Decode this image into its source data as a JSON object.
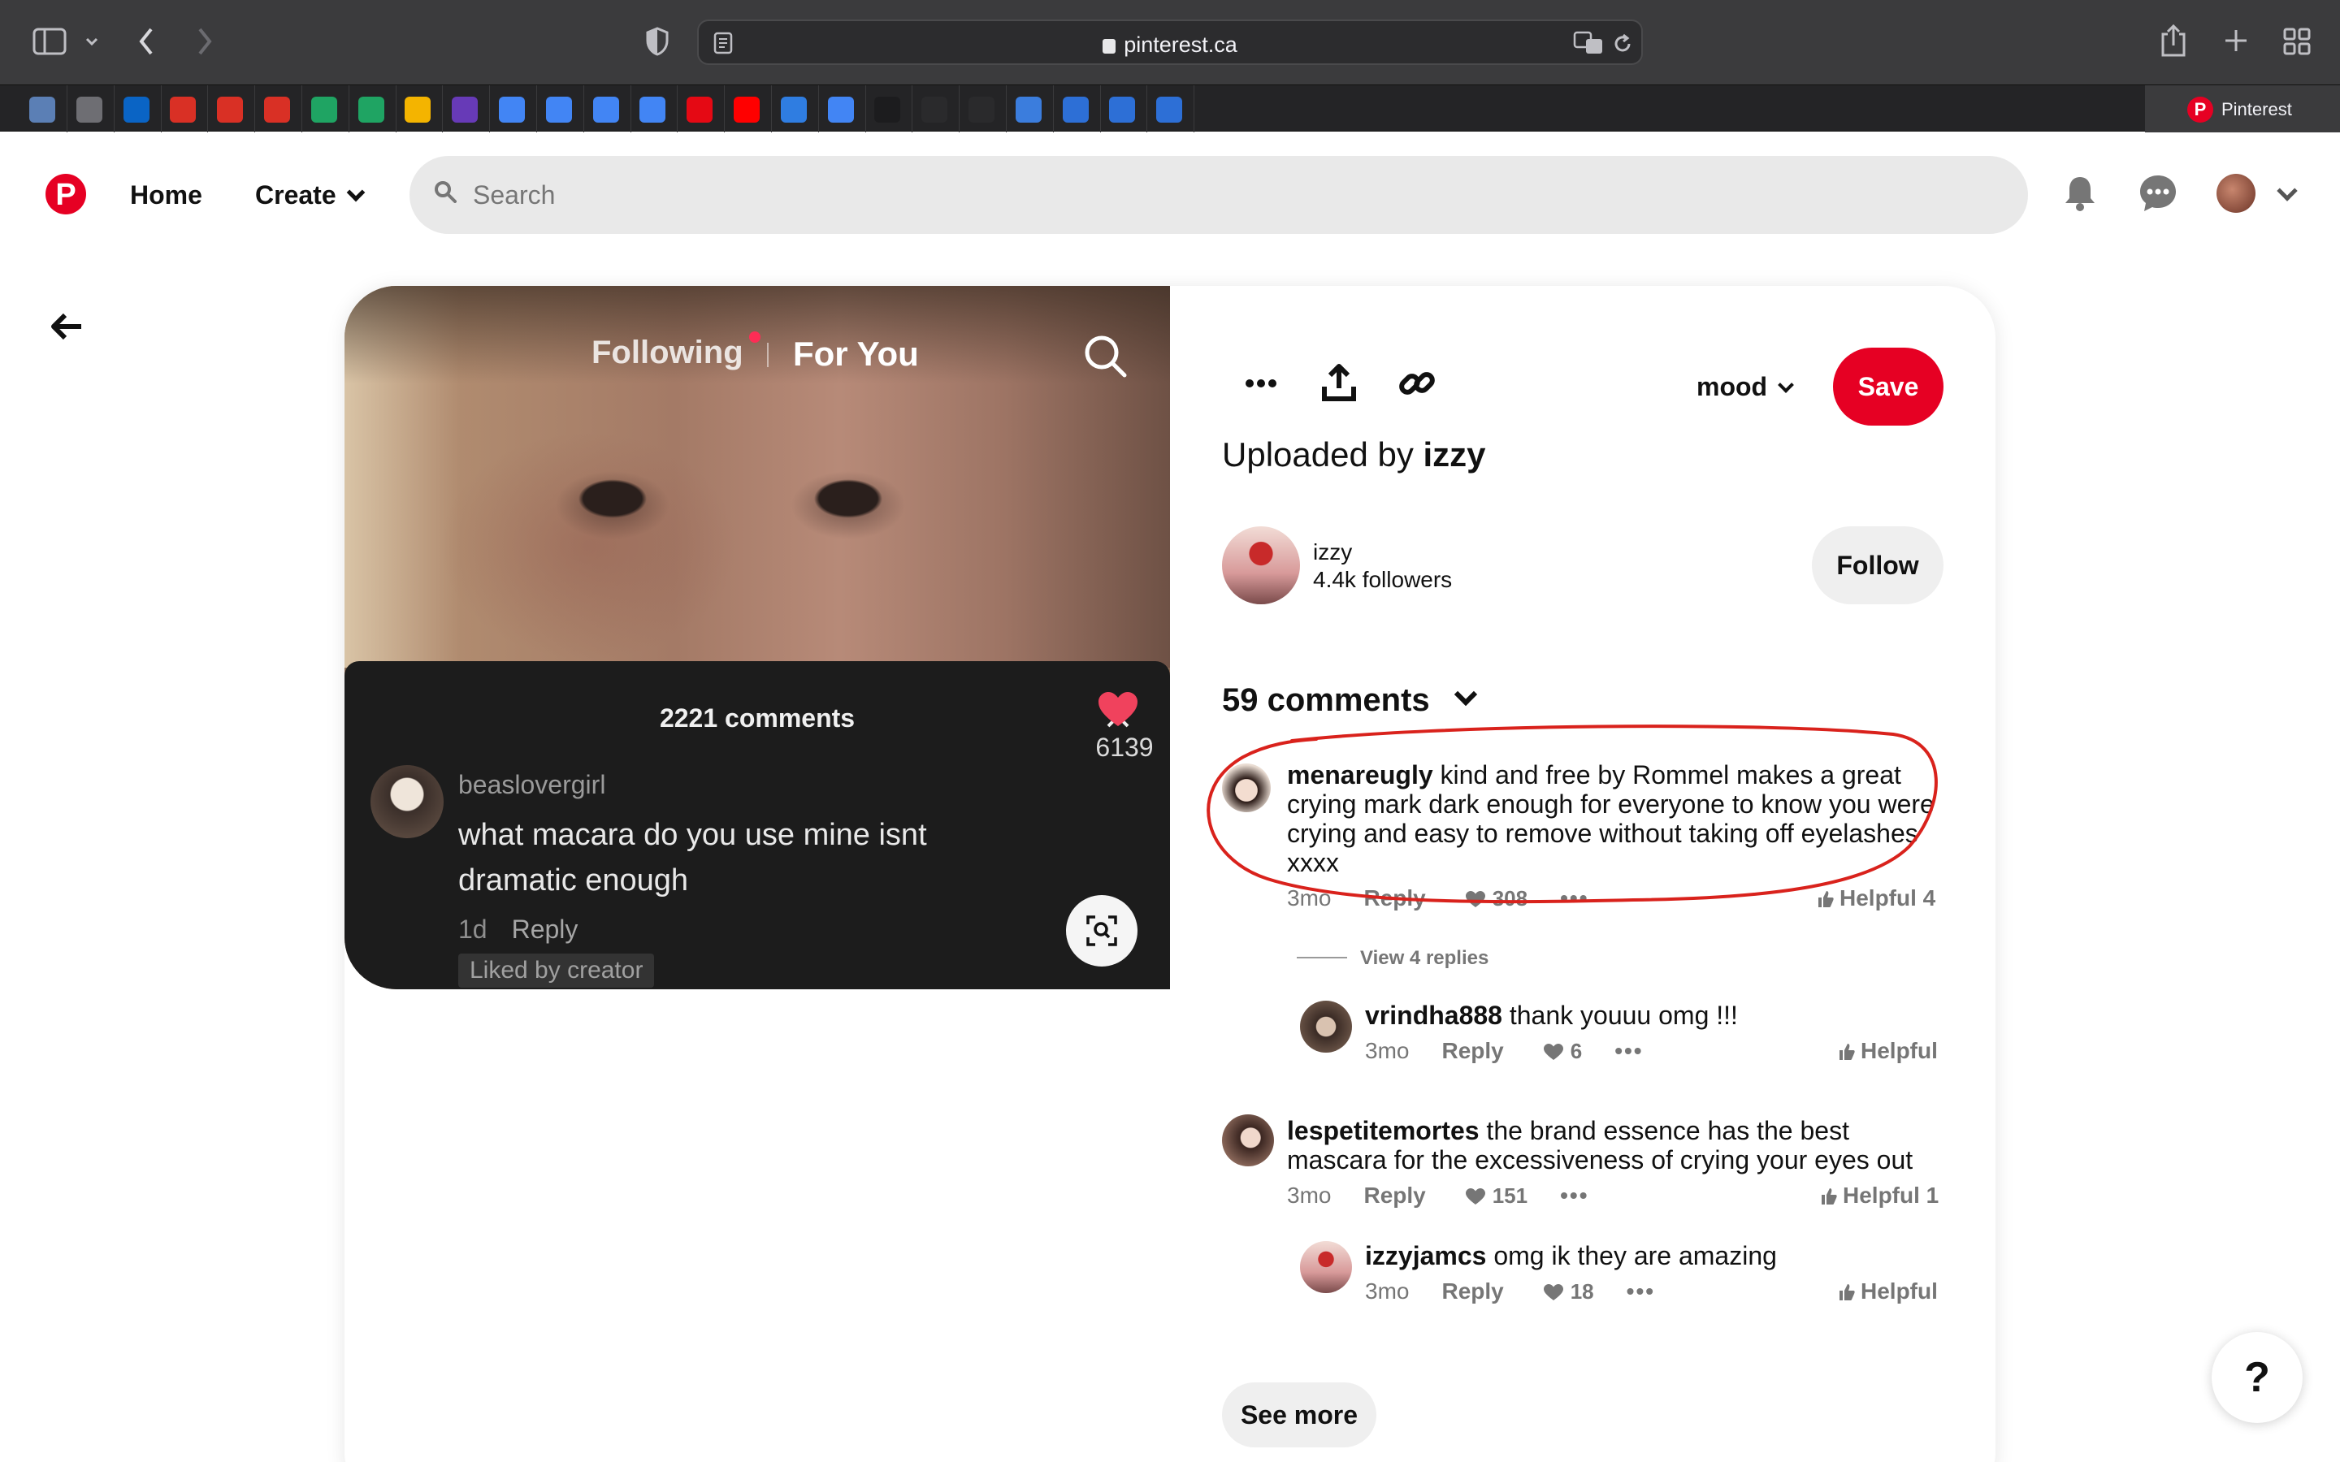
{
  "browser": {
    "url": "pinterest.ca",
    "active_tab": "Pinterest",
    "favorites": [
      {
        "icon": "globe-icon",
        "color": "#5b7fb5"
      },
      {
        "icon": "globe-icon",
        "color": "#6e6e73"
      },
      {
        "icon": "outlook-icon",
        "color": "#0a64c5"
      },
      {
        "icon": "gmail-icon",
        "color": "#d93025"
      },
      {
        "icon": "gmail-icon",
        "color": "#d93025"
      },
      {
        "icon": "gmail-icon",
        "color": "#d93025"
      },
      {
        "icon": "drive-icon",
        "color": "#1fa463"
      },
      {
        "icon": "drive-icon",
        "color": "#1fa463"
      },
      {
        "icon": "slides-icon",
        "color": "#f4b400"
      },
      {
        "icon": "forms-icon",
        "color": "#673ab7"
      },
      {
        "icon": "docs-icon",
        "color": "#4285f4"
      },
      {
        "icon": "docs-icon",
        "color": "#4285f4"
      },
      {
        "icon": "docs-icon",
        "color": "#4285f4"
      },
      {
        "icon": "docs-icon",
        "color": "#4285f4"
      },
      {
        "icon": "netflix-icon",
        "color": "#e50914"
      },
      {
        "icon": "youtube-icon",
        "color": "#ff0000"
      },
      {
        "icon": "play-icon",
        "color": "#2f7de1"
      },
      {
        "icon": "calendar-icon",
        "color": "#4285f4"
      },
      {
        "icon": "grid-icon",
        "color": "#1c1c1e"
      },
      {
        "icon": "life-icon",
        "color": "#2a2a2c"
      },
      {
        "icon": "life-icon",
        "color": "#2a2a2c"
      },
      {
        "icon": "squares-icon",
        "color": "#3b7ddd"
      },
      {
        "icon": "circle-c-icon",
        "color": "#2d6fd6"
      },
      {
        "icon": "circle-c-icon",
        "color": "#2d6fd6"
      },
      {
        "icon": "circle-c-icon",
        "color": "#2d6fd6"
      }
    ]
  },
  "header": {
    "home": "Home",
    "create": "Create",
    "search_placeholder": "Search"
  },
  "media": {
    "tab_following": "Following",
    "tab_for_you": "For You",
    "comments_count": "2221 comments",
    "comment": {
      "user": "beaslovergirl",
      "text": "what macara do you use mine isnt dramatic enough",
      "time": "1d",
      "reply": "Reply",
      "liked_by": "Liked by creator",
      "likes": "6139"
    }
  },
  "pin": {
    "board": "mood",
    "save": "Save",
    "uploaded_prefix": "Uploaded by",
    "uploader": "izzy",
    "creator_name": "izzy",
    "followers": "4.4k followers",
    "follow": "Follow"
  },
  "comments": {
    "header": "59 comments",
    "items": [
      {
        "user": "menareugly",
        "text": "kind and free by Rommel makes a great crying mark dark enough for everyone to know you were crying and easy to remove without taking off eyelashes xxxx",
        "time": "3mo",
        "reply": "Reply",
        "likes": "308",
        "helpful": "Helpful 4"
      },
      {
        "user": "vrindha888",
        "text": "thank youuu omg !!!",
        "time": "3mo",
        "reply": "Reply",
        "likes": "6",
        "helpful": "Helpful"
      },
      {
        "user": "lespetitemortes",
        "text": "the brand essence has the best mascara for the excessiveness of crying your eyes out",
        "time": "3mo",
        "reply": "Reply",
        "likes": "151",
        "helpful": "Helpful 1"
      },
      {
        "user": "izzyjamcs",
        "text": "omg ik they are amazing",
        "time": "3mo",
        "reply": "Reply",
        "likes": "18",
        "helpful": "Helpful"
      }
    ],
    "view_replies": "View 4 replies",
    "see_more": "See more"
  },
  "help": "?",
  "colors": {
    "brand": "#e60023",
    "annotation": "#d9221c"
  }
}
